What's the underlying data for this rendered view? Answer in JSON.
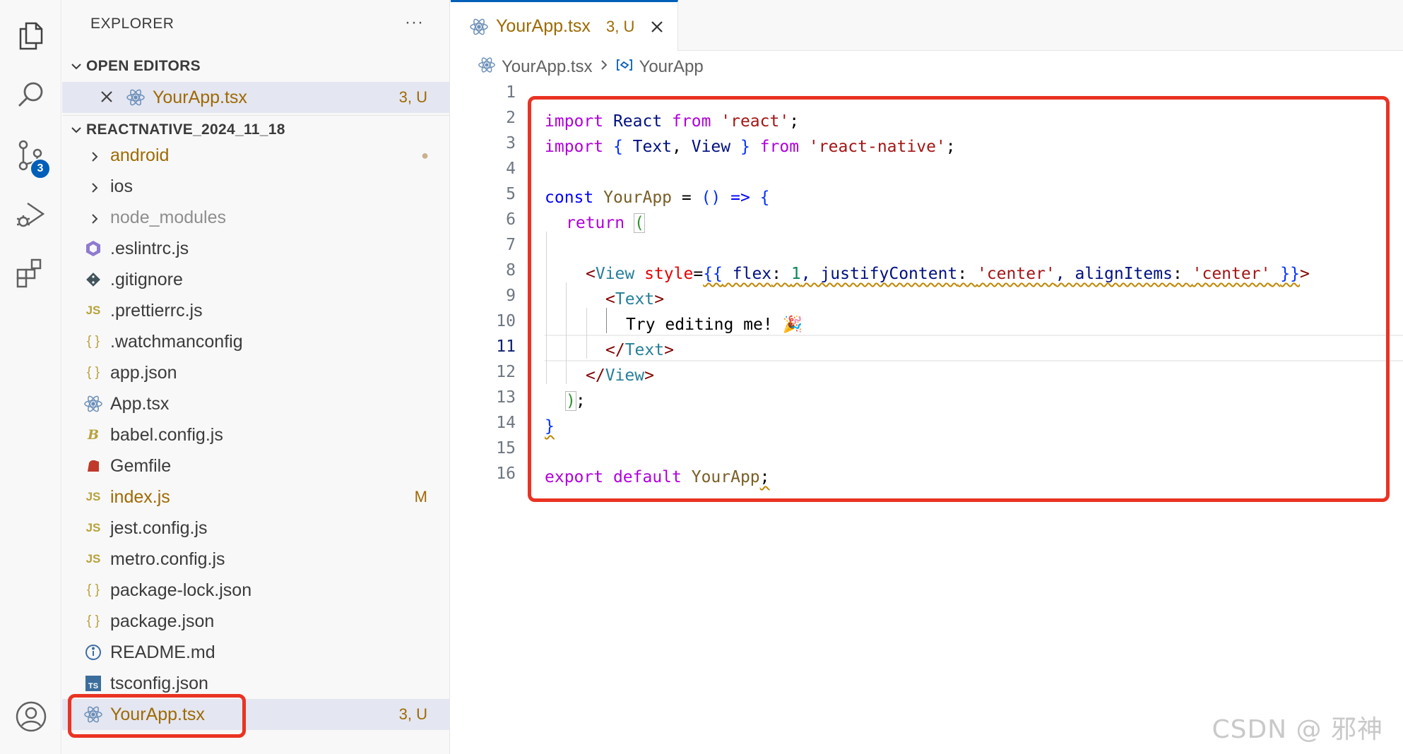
{
  "sidebar": {
    "title": "EXPLORER",
    "more": "···",
    "open_editors": {
      "label": "OPEN EDITORS",
      "items": [
        {
          "name": "YourApp.tsx",
          "status": "3, U"
        }
      ]
    },
    "project": {
      "label": "REACTNATIVE_2024_11_18",
      "items": [
        {
          "name": "android",
          "kind": "folder",
          "status": "●",
          "color": "#9e6a03"
        },
        {
          "name": "ios",
          "kind": "folder",
          "status": ""
        },
        {
          "name": "node_modules",
          "kind": "folder",
          "status": "",
          "color": "#8e8e8e"
        },
        {
          "name": ".eslintrc.js",
          "icon": "eslint-icon",
          "status": ""
        },
        {
          "name": ".gitignore",
          "icon": "git-icon",
          "status": ""
        },
        {
          "name": ".prettierrc.js",
          "icon": "js-icon",
          "status": ""
        },
        {
          "name": ".watchmanconfig",
          "icon": "json-icon",
          "status": ""
        },
        {
          "name": "app.json",
          "icon": "json-icon",
          "status": ""
        },
        {
          "name": "App.tsx",
          "icon": "react-icon",
          "status": ""
        },
        {
          "name": "babel.config.js",
          "icon": "babel-icon",
          "status": ""
        },
        {
          "name": "Gemfile",
          "icon": "ruby-icon",
          "status": ""
        },
        {
          "name": "index.js",
          "icon": "js-icon",
          "status": "M",
          "color": "#9e6a03"
        },
        {
          "name": "jest.config.js",
          "icon": "js-icon",
          "status": ""
        },
        {
          "name": "metro.config.js",
          "icon": "js-icon",
          "status": ""
        },
        {
          "name": "package-lock.json",
          "icon": "json-icon",
          "status": ""
        },
        {
          "name": "package.json",
          "icon": "json-icon",
          "status": ""
        },
        {
          "name": "README.md",
          "icon": "info-icon",
          "status": ""
        },
        {
          "name": "tsconfig.json",
          "icon": "ts-icon",
          "status": ""
        },
        {
          "name": "YourApp.tsx",
          "icon": "react-icon",
          "status": "3, U",
          "color": "#9e6a03"
        }
      ]
    }
  },
  "activity": {
    "scm_badge": "3"
  },
  "editor": {
    "tab": {
      "label": "YourApp.tsx",
      "status": "3, U"
    },
    "breadcrumb": {
      "file": "YourApp.tsx",
      "symbol": "YourApp"
    },
    "line_numbers": [
      "1",
      "2",
      "3",
      "4",
      "5",
      "6",
      "7",
      "8",
      "9",
      "10",
      "11",
      "12",
      "13",
      "14",
      "15",
      "16"
    ],
    "active_line": "11",
    "code": {
      "l2": [
        "import",
        " React ",
        "from",
        " 'react'",
        ";"
      ],
      "l3": [
        "import",
        " { ",
        "Text",
        ", ",
        "View",
        " } ",
        "from",
        " 'react-native'",
        ";"
      ],
      "l5": [
        "const",
        " YourApp ",
        "= ",
        "()",
        " => ",
        "{"
      ],
      "l6": [
        "return",
        " ",
        "("
      ],
      "l8": [
        "<",
        "View",
        " style",
        "=",
        "{{",
        " flex",
        ": ",
        "1",
        ", justifyContent",
        ": ",
        "'center'",
        ", alignItems",
        ": ",
        "'center'",
        " ",
        "}}",
        ">"
      ],
      "l9": [
        "<",
        "Text",
        ">"
      ],
      "l10": [
        "Try editing me! 🎉"
      ],
      "l11": [
        "</",
        "Text",
        ">"
      ],
      "l12": [
        "</",
        "View",
        ">"
      ],
      "l13": [
        ")",
        ";"
      ],
      "l14": [
        "}"
      ],
      "l16": [
        "export",
        " default",
        " YourApp",
        ";"
      ]
    }
  },
  "watermark": "CSDN @  邪神"
}
